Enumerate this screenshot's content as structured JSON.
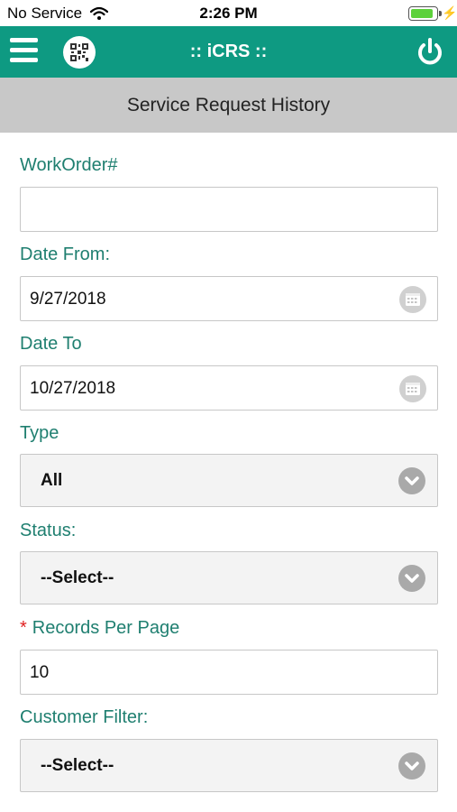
{
  "status_bar": {
    "carrier": "No Service",
    "time": "2:26 PM",
    "battery_level": 0.9,
    "icons": [
      "wifi-icon",
      "battery-icon",
      "charging-bolt-icon"
    ]
  },
  "app_bar": {
    "title": ":: iCRS ::",
    "color": "#0e9a82",
    "icons": [
      "hamburger-menu-icon",
      "qr-code-icon",
      "power-icon"
    ]
  },
  "subheader": {
    "title": "Service Request History"
  },
  "form": {
    "workorder": {
      "label": "WorkOrder#",
      "value": ""
    },
    "date_from": {
      "label": "Date From:",
      "value": "9/27/2018"
    },
    "date_to": {
      "label": "Date To",
      "value": "10/27/2018"
    },
    "type": {
      "label": "Type",
      "value": "All"
    },
    "status": {
      "label": "Status:",
      "value": "--Select--"
    },
    "records_per_page": {
      "required_mark": "*",
      "label": "Records Per Page",
      "value": "10"
    },
    "customer_filter": {
      "label": "Customer Filter:",
      "value": "--Select--"
    }
  }
}
